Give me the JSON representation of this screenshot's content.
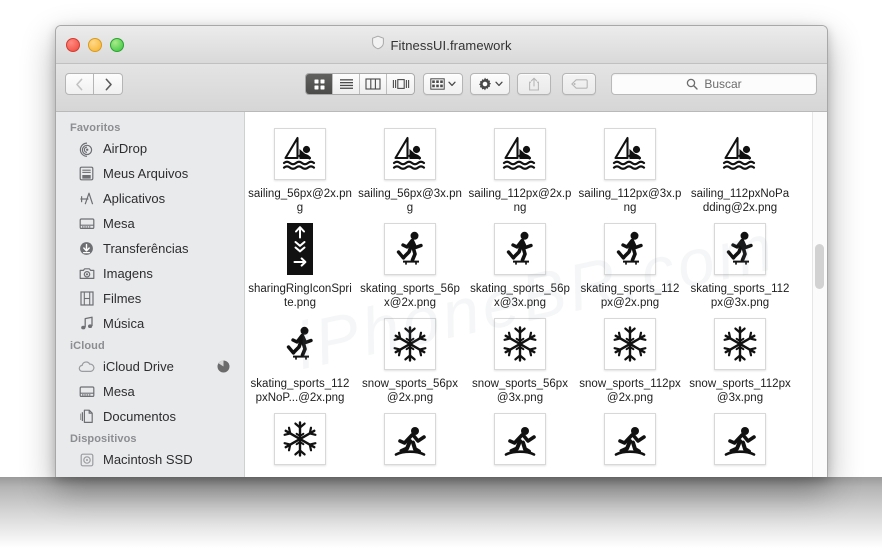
{
  "window": {
    "title": "FitnessUI.framework",
    "title_icon": "shield-icon",
    "traffic_lights": [
      {
        "name": "close",
        "color": "#f0483c"
      },
      {
        "name": "minimize",
        "color": "#f6b22b"
      },
      {
        "name": "zoom",
        "color": "#35c43c"
      }
    ]
  },
  "toolbar": {
    "back_label": "‹",
    "forward_label": "›",
    "back_enabled": false,
    "forward_enabled": true,
    "view_modes": [
      {
        "name": "icon-view",
        "icon": "grid-icon",
        "active": true
      },
      {
        "name": "list-view",
        "icon": "list-icon",
        "active": false
      },
      {
        "name": "column-view",
        "icon": "columns-icon",
        "active": false
      },
      {
        "name": "gallery-view",
        "icon": "gallery-icon",
        "active": false
      }
    ],
    "arrange": {
      "name": "arrange-button",
      "icon": "arrange-icon",
      "enabled": true
    },
    "action": {
      "name": "action-button",
      "icon": "gear-icon",
      "enabled": true
    },
    "share": {
      "name": "share-button",
      "icon": "share-icon",
      "enabled": false
    },
    "tags": {
      "name": "tags-button",
      "icon": "tag-icon",
      "enabled": false
    }
  },
  "search": {
    "placeholder": "Buscar",
    "value": "",
    "icon": "search-icon"
  },
  "sidebar": {
    "sections": [
      {
        "header": "Favoritos",
        "items": [
          {
            "label": "AirDrop",
            "icon": "airdrop-icon"
          },
          {
            "label": "Meus Arquivos",
            "icon": "all-my-files-icon"
          },
          {
            "label": "Aplicativos",
            "icon": "applications-icon"
          },
          {
            "label": "Mesa",
            "icon": "desktop-icon"
          },
          {
            "label": "Transferências",
            "icon": "downloads-icon"
          },
          {
            "label": "Imagens",
            "icon": "pictures-icon"
          },
          {
            "label": "Filmes",
            "icon": "movies-icon"
          },
          {
            "label": "Música",
            "icon": "music-icon"
          }
        ]
      },
      {
        "header": "iCloud",
        "items": [
          {
            "label": "iCloud Drive",
            "icon": "cloud-icon",
            "badge": "sync-progress-indicator"
          },
          {
            "label": "Mesa",
            "icon": "desktop-icon"
          },
          {
            "label": "Documentos",
            "icon": "documents-icon"
          }
        ]
      },
      {
        "header": "Dispositivos",
        "items": [
          {
            "label": "Macintosh SSD",
            "icon": "disk-icon"
          }
        ]
      }
    ]
  },
  "content": {
    "files": [
      {
        "name": "sailing_56px@2x.png",
        "icon": "sailing-icon",
        "framed": true
      },
      {
        "name": "sailing_56px@3x.png",
        "icon": "sailing-icon",
        "framed": true
      },
      {
        "name": "sailing_112px@2x.png",
        "icon": "sailing-icon",
        "framed": true
      },
      {
        "name": "sailing_112px@3x.png",
        "icon": "sailing-icon",
        "framed": true
      },
      {
        "name": "sailing_112pxNoPadding@2x.png",
        "icon": "sailing-icon",
        "framed": false
      },
      {
        "name": "sharingRingIconSprite.png",
        "icon": "sharing-ring-sprite-icon",
        "framed": false
      },
      {
        "name": "skating_sports_56px@2x.png",
        "icon": "skating-icon",
        "framed": true
      },
      {
        "name": "skating_sports_56px@3x.png",
        "icon": "skating-icon",
        "framed": true
      },
      {
        "name": "skating_sports_112px@2x.png",
        "icon": "skating-icon",
        "framed": true
      },
      {
        "name": "skating_sports_112px@3x.png",
        "icon": "skating-icon",
        "framed": true
      },
      {
        "name": "skating_sports_112pxNoP...@2x.png",
        "icon": "skating-icon",
        "framed": false
      },
      {
        "name": "snow_sports_56px@2x.png",
        "icon": "snowflake-icon",
        "framed": true
      },
      {
        "name": "snow_sports_56px@3x.png",
        "icon": "snowflake-icon",
        "framed": true
      },
      {
        "name": "snow_sports_112px@2x.png",
        "icon": "snowflake-icon",
        "framed": true
      },
      {
        "name": "snow_sports_112px@3x.png",
        "icon": "snowflake-icon",
        "framed": true
      },
      {
        "name": "",
        "icon": "snowflake-icon",
        "framed": true
      },
      {
        "name": "",
        "icon": "snowboarding-icon",
        "framed": true
      },
      {
        "name": "",
        "icon": "snowboarding-icon",
        "framed": true
      },
      {
        "name": "",
        "icon": "snowboarding-icon",
        "framed": true
      },
      {
        "name": "",
        "icon": "snowboarding-icon",
        "framed": true
      }
    ]
  },
  "scrollbar": {
    "orientation": "vertical",
    "thumb_position_pct": 41
  },
  "watermark": {
    "text": "iPhoneBR.com"
  }
}
